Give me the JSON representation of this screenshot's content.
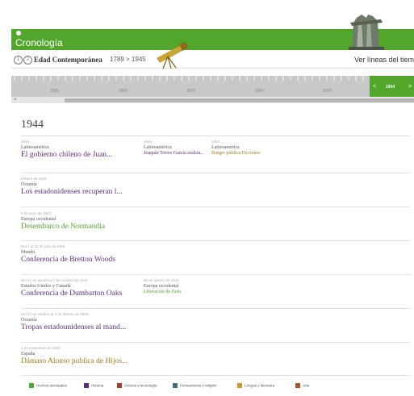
{
  "header": {
    "title": "Cronología",
    "color": "#52a62c"
  },
  "breadcrumb": {
    "icon1": "1",
    "icon2": "2",
    "era": "Edad Contemporánea",
    "range": "1789 > 1945",
    "view_lines": "Ver líneas del tiemp"
  },
  "timeline": {
    "years": [
      "1825",
      "1850",
      "1875",
      "1900",
      "1925"
    ],
    "current_year": "1944",
    "prev": "<",
    "next": ">",
    "scroll_arrow": "◂"
  },
  "year_heading": "1944",
  "events": [
    {
      "date": "1944",
      "region": "Latinoamérica",
      "title": "El gobierno chileno de Juan...",
      "category": "history"
    },
    {
      "date": "1944",
      "region": "Latinoamérica",
      "title": "Joaquín Torres García realiza...",
      "category": "art"
    },
    {
      "date": "1944",
      "region": "Latinoamérica",
      "title": "Borges publica Ficciones",
      "category": "literature"
    },
    {
      "date": "febrero de 1944",
      "region": "Oceanía",
      "title": "Los estadonidenses recuperan l...",
      "category": "history"
    },
    {
      "date": "6 de junio de 1944",
      "region": "Europa occidental",
      "title": "Desembarco de Normandía",
      "category": "main"
    },
    {
      "date": "Del 1 al 22 de julio de 1944",
      "region": "Mundo",
      "title": "Conferencia de Bretton Woods",
      "category": "history"
    },
    {
      "date": "Del 21 de agosto al 7 de octubre de 1944",
      "region": "Estados Unidos y Canadá",
      "title": "Conferencia de Dumbarton Oaks",
      "category": "history"
    },
    {
      "date": "25 de agosto de 1944",
      "region": "Europa occidental",
      "title": "Liberación de París",
      "category": "main"
    },
    {
      "date": "Del 17 de octubre al 4 de febrero de 1945",
      "region": "Oceanía",
      "title": "Tropas estadounidenses al mand...",
      "category": "history"
    },
    {
      "date": "4 de noviembre de 1944",
      "region": "España",
      "title": "Dámaso Alonso publica de Hijos...",
      "category": "literature"
    }
  ],
  "legend": [
    {
      "label": "Hechos principales",
      "color": "#52a62c"
    },
    {
      "label": "Historia",
      "color": "#5b2c7e"
    },
    {
      "label": "Ciencia y tecnología",
      "color": "#b33a2a"
    },
    {
      "label": "Pensamiento y religión",
      "color": "#3d6f80"
    },
    {
      "label": "Lengua y literatura",
      "color": "#c59a2a"
    },
    {
      "label": "Arte",
      "color": "#a05a2c"
    }
  ]
}
